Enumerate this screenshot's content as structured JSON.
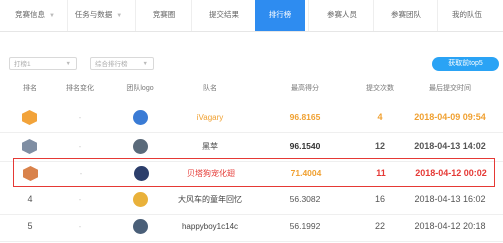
{
  "nav": {
    "tabs": [
      {
        "label": "竞赛信息",
        "caret": true
      },
      {
        "label": "任务与数据",
        "caret": true
      },
      {
        "label": "竞赛圈",
        "caret": false
      },
      {
        "label": "提交结果",
        "caret": false
      },
      {
        "label": "排行榜",
        "caret": false,
        "active": true
      },
      {
        "label": "参赛人员",
        "caret": false
      },
      {
        "label": "参赛团队",
        "caret": false
      },
      {
        "label": "我的队伍",
        "caret": false
      }
    ]
  },
  "filters": {
    "board": "打榜1",
    "type": "综合排行榜",
    "button": "获取前top5"
  },
  "columns": [
    "排名",
    "排名变化",
    "团队logo",
    "队名",
    "最高得分",
    "提交次数",
    "最后提交时间"
  ],
  "rows": [
    {
      "rank": "",
      "change": "-",
      "team": "iVagary",
      "score": "96.8165",
      "subs": "4",
      "time": "2018-04-09 09:54",
      "medal": "#f2a33a",
      "logo": "#3a7bd5",
      "score_color": "#f0a030",
      "highlight": false
    },
    {
      "rank": "",
      "change": "-",
      "team": "黑苹",
      "score": "96.1540",
      "subs": "12",
      "time": "2018-04-13 14:02",
      "medal": "#7f8ea3",
      "logo": "#5a6a7a",
      "score_color": "#333333",
      "highlight": false
    },
    {
      "rank": "",
      "change": "-",
      "team": "贝塔狗宠化翅",
      "score": "71.4004",
      "subs": "11",
      "time": "2018-04-12 00:02",
      "medal": "#d9824b",
      "logo": "#2c3e6b",
      "score_color": "#f0a030",
      "highlight": true
    },
    {
      "rank": "4",
      "change": "-",
      "team": "大风车的童年回忆",
      "score": "56.3082",
      "subs": "16",
      "time": "2018-04-13 16:02",
      "medal": "",
      "logo": "#e9b13a",
      "score_color": "#555555",
      "highlight": false
    },
    {
      "rank": "5",
      "change": "-",
      "team": "happyboy1c14c",
      "score": "56.1992",
      "subs": "22",
      "time": "2018-04-12 20:18",
      "medal": "",
      "logo": "#4a5f78",
      "score_color": "#555555",
      "highlight": false
    }
  ]
}
